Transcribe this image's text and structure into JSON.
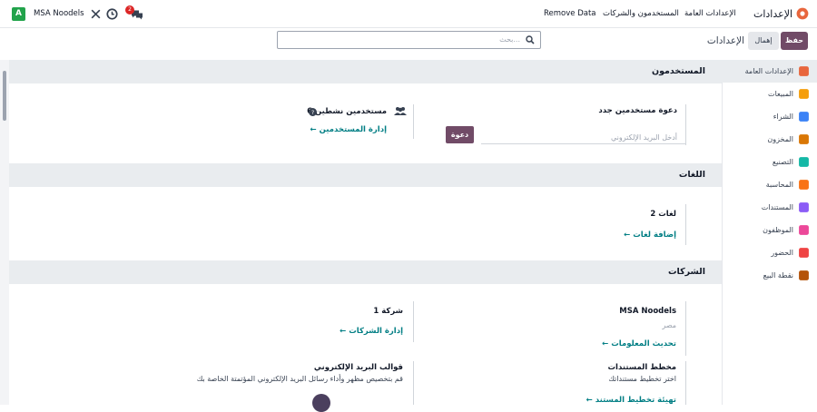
{
  "navbar": {
    "avatar_letter": "A",
    "company_name": "MSA Noodels",
    "messages_count": "2",
    "app_title": "الإعدادات",
    "menu": {
      "general_settings": "الإعدادات العامة",
      "users_companies": "المستخدمون والشركات",
      "remove_data": "Remove Data"
    }
  },
  "control": {
    "save_label": "حفظ",
    "discard_label": "إهمال",
    "breadcrumb": "الإعدادات",
    "search_placeholder": "بحث..."
  },
  "sections": {
    "users": {
      "title": "المستخدمون",
      "invite_title": "دعوة مستخدمين جدد",
      "invite_placeholder": "أدخل البريد الإلكتروني",
      "invite_button": "دعوة",
      "active_users": "6 مستخدمين نشطين",
      "manage_users": "إدارة المستخدمين"
    },
    "languages": {
      "title": "اللغات",
      "count": "2 لغات",
      "add_languages": "إضافة لغات"
    },
    "companies": {
      "title": "الشركات",
      "company_name": "MSA Noodels",
      "country": "مصر",
      "update_info": "تحديث المعلومات",
      "count": "1 شركة",
      "manage_companies": "إدارة الشركات",
      "layout_title": "مخطط المستندات",
      "layout_desc": "اختر تخطيط مستنداتك",
      "layout_link": "تهيئة تخطيط المستند",
      "email_templates_title": "قوالب البريد الإلكتروني",
      "email_templates_desc": "قم بتخصيص مظهر وأداء رسائل البريد الإلكتروني المؤتمتة الخاصة بك"
    }
  },
  "sidebar": {
    "items": [
      {
        "label": "الإعدادات العامة",
        "color": "#e8663d"
      },
      {
        "label": "المبيعات",
        "color": "#f59e0b"
      },
      {
        "label": "الشراء",
        "color": "#3b82f6"
      },
      {
        "label": "المخزون",
        "color": "#d97706"
      },
      {
        "label": "التصنيع",
        "color": "#14b8a6"
      },
      {
        "label": "المحاسبة",
        "color": "#f97316"
      },
      {
        "label": "المستندات",
        "color": "#8b5cf6"
      },
      {
        "label": "الموظفون",
        "color": "#ec4899"
      },
      {
        "label": "الحضور",
        "color": "#ef4444"
      },
      {
        "label": "نقطة البيع",
        "color": "#b45309"
      }
    ]
  },
  "colors": {
    "brand": "#714b67",
    "link": "#017e84",
    "section_bg": "#e9ecef"
  }
}
